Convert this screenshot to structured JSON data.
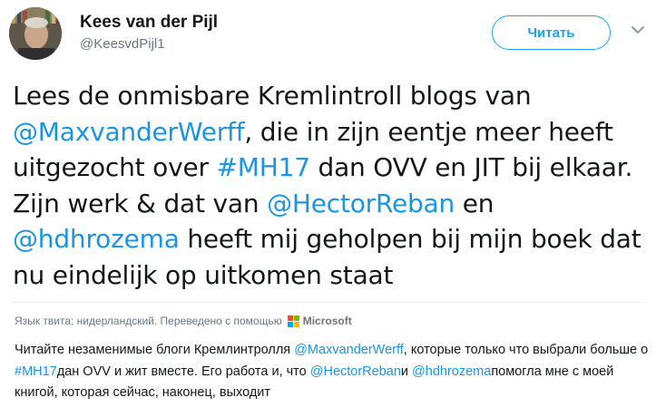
{
  "user": {
    "display_name": "Kees van der Pijl",
    "handle": "@KeesvdPijl1"
  },
  "actions": {
    "follow_label": "Читать"
  },
  "tweet": {
    "segments": [
      {
        "text": "Lees de onmisbare Kremlintroll blogs van ",
        "link": false
      },
      {
        "text": "@MaxvanderWerff",
        "link": true
      },
      {
        "text": ", die in zijn eentje meer heeft uitgezocht over ",
        "link": false
      },
      {
        "text": "#MH17",
        "link": true
      },
      {
        "text": " dan OVV en JIT bij elkaar. Zijn werk & dat van ",
        "link": false
      },
      {
        "text": "@HectorReban",
        "link": true
      },
      {
        "text": " en ",
        "link": false
      },
      {
        "text": "@hdhrozema",
        "link": true
      },
      {
        "text": " heeft mij geholpen bij mijn boek dat nu eindelijk op uitkomen staat",
        "link": false
      }
    ]
  },
  "translation": {
    "note": "Язык твита: нидерландский. Переведено с помощью",
    "provider": "Microsoft",
    "segments": [
      {
        "text": "Читайте незаменимые блоги Кремлинтролля ",
        "link": false
      },
      {
        "text": "@MaxvanderWerff",
        "link": true
      },
      {
        "text": ", которые только что выбрали больше о ",
        "link": false
      },
      {
        "text": "#MH17",
        "link": true
      },
      {
        "text": "дан OVV и жит вместе. Его работа и, что ",
        "link": false
      },
      {
        "text": "@HectorReban",
        "link": true
      },
      {
        "text": "и ",
        "link": false
      },
      {
        "text": "@hdhrozema",
        "link": true
      },
      {
        "text": "помогла мне с моей книгой, которая сейчас, наконец, выходит",
        "link": false
      }
    ]
  },
  "colors": {
    "link": "#1b95e0",
    "follow_accent": "#1da1f2",
    "muted_text": "#657786",
    "ms_red": "#f25022",
    "ms_green": "#7fba00",
    "ms_blue": "#00a4ef",
    "ms_yellow": "#ffb900"
  },
  "icons": {
    "avatar": "avatar",
    "menu": "chevron-down-icon",
    "provider_logo": "microsoft-logo-icon"
  }
}
